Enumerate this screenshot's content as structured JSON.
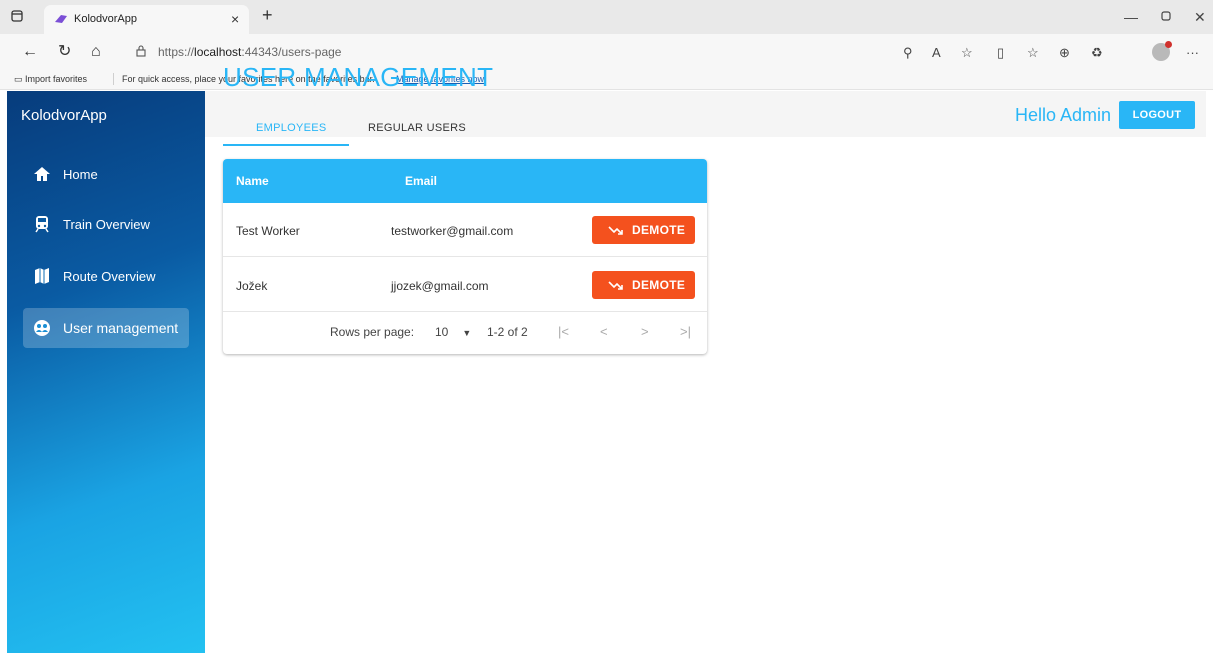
{
  "browser": {
    "tab_title": "KolodvorApp",
    "tab_close": "×",
    "new_tab": "+",
    "url_prefix": "https://",
    "url_host": "localhost",
    "url_rest": ":44343/users-page",
    "favorites": {
      "import_label": "Import favorites",
      "message": "For quick access, place your favorites here on the favorites bar.",
      "manage_link": "Manage favorites now"
    }
  },
  "app": {
    "brand": "KolodvorApp",
    "nav": [
      {
        "label": "Home",
        "icon": "home-icon"
      },
      {
        "label": "Train Overview",
        "icon": "train-icon"
      },
      {
        "label": "Route Overview",
        "icon": "map-icon"
      },
      {
        "label": "User management",
        "icon": "users-icon",
        "active": true
      }
    ],
    "header": {
      "greeting": "Hello Admin",
      "logout_label": "LOGOUT"
    },
    "page_title": "USER MANAGEMENT",
    "tabs": [
      {
        "label": "EMPLOYEES",
        "active": true
      },
      {
        "label": "REGULAR USERS",
        "active": false
      }
    ],
    "table": {
      "columns": [
        "Name",
        "Email"
      ],
      "rows": [
        {
          "name": "Test Worker",
          "email": "testworker@gmail.com",
          "action": "DEMOTE"
        },
        {
          "name": "Jožek",
          "email": "jjozek@gmail.com",
          "action": "DEMOTE"
        }
      ],
      "pagination": {
        "rows_per_page_label": "Rows per page:",
        "rows_per_page_value": "10",
        "range": "1-2 of 2"
      }
    }
  },
  "colors": {
    "accent": "#29b6f6",
    "danger": "#f4511e",
    "sidebar_top": "#073c7c",
    "sidebar_bottom": "#23c1f1"
  }
}
